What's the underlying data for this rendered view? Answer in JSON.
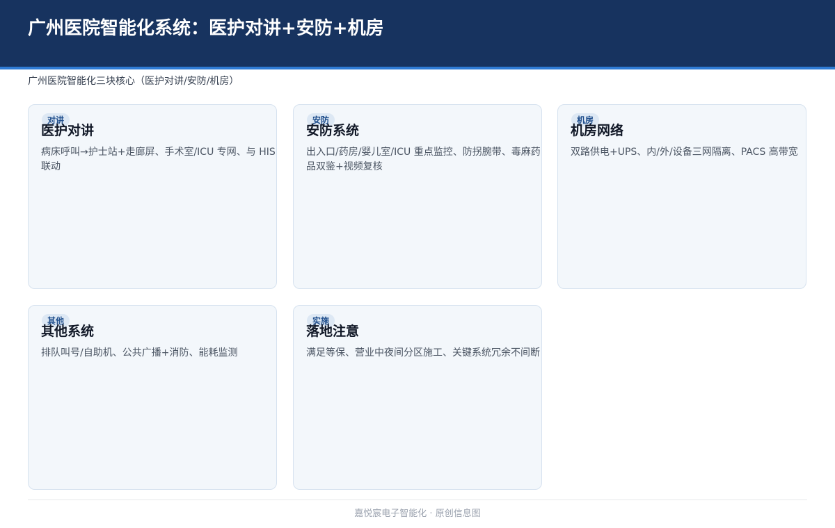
{
  "header": {
    "title": "广州医院智能化系统：医护对讲+安防+机房"
  },
  "subtitle": "广州医院智能化三块核心（医护对讲/安防/机房）",
  "cards": [
    {
      "tag": "对讲",
      "title": "医护对讲",
      "desc": "病床呼叫→护士站+走廊屏、手术室/ICU 专网、与 HIS 联动"
    },
    {
      "tag": "安防",
      "title": "安防系统",
      "desc": "出入口/药房/婴儿室/ICU 重点监控、防拐腕带、毒麻药品双鉴+视频复核"
    },
    {
      "tag": "机房",
      "title": "机房网络",
      "desc": "双路供电+UPS、内/外/设备三网隔离、PACS 高带宽"
    },
    {
      "tag": "其他",
      "title": "其他系统",
      "desc": "排队叫号/自助机、公共广播+消防、能耗监测"
    },
    {
      "tag": "实施",
      "title": "落地注意",
      "desc": "满足等保、营业中夜间分区施工、关键系统冗余不间断"
    }
  ],
  "footer": {
    "text": "嘉悦宸电子智能化 · 原创信息图"
  },
  "colors": {
    "header_bg": "#17335f",
    "header_accent": "#2f7bd4",
    "card_bg": "#f3f7fb",
    "card_border": "#d6e2ef",
    "tag_bg": "#dde8f4",
    "tag_text": "#1f4e8c"
  }
}
